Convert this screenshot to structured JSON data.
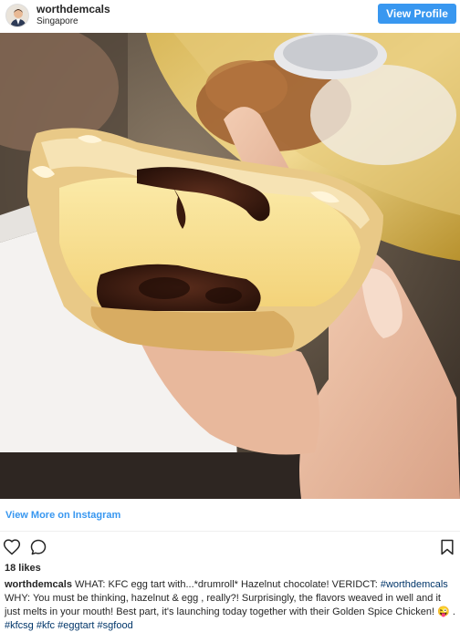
{
  "header": {
    "username": "worthdemcals",
    "location": "Singapore",
    "view_profile_label": "View Profile"
  },
  "photo": {
    "subject": "egg-tart-photo"
  },
  "footer": {
    "view_more_label": "View More on Instagram",
    "likes_text": "18 likes"
  },
  "caption": {
    "username": "worthdemcals",
    "body_part1": "WHAT: KFC egg tart with...*drumroll* Hazelnut chocolate! VERIDCT: ",
    "mention": "#worthdemcals",
    "body_part2": " WHY: You must be thinking, hazelnut & egg , really?! Surprisingly, the flavors weaved in well and it just melts in your mouth! Best part, it's launching today together with their Golden Spice Chicken! 😜 . ",
    "hashtags": [
      "#kfcsg",
      "#kfc",
      "#eggtart",
      "#sgfood"
    ]
  },
  "colors": {
    "accent": "#3897f0",
    "tag": "#003569",
    "text": "#262626"
  },
  "icons": {
    "like": "heart-icon",
    "comment": "comment-icon",
    "save": "bookmark-icon",
    "user_tag": "user-tag-icon"
  }
}
